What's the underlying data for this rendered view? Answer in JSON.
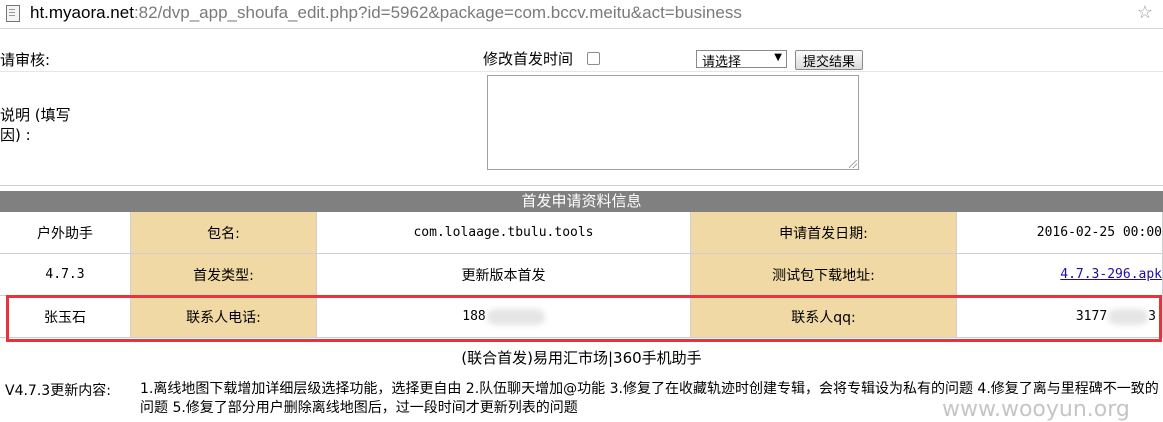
{
  "address_bar": {
    "host": "ht.myaora.net",
    "path": ":82/dvp_app_shoufa_edit.php?id=5962&package=com.bccv.meitu&act=business"
  },
  "form": {
    "review_label": "请审核:",
    "modify_time_label": "修改首发时间",
    "modify_time_checked": false,
    "select_value": "请选择",
    "submit_label": "提交结果",
    "reason_label_line1": "说明 (填写",
    "reason_label_line2": "因) :",
    "reason_value": ""
  },
  "section_title": "首发申请资料信息",
  "info": {
    "app_name": "户外助手",
    "package_label": "包名:",
    "package_value": "com.lolaage.tbulu.tools",
    "apply_date_label": "申请首发日期:",
    "apply_date_value": "2016-02-25 00:00",
    "version": "4.7.3",
    "type_label": "首发类型:",
    "type_value": "更新版本首发",
    "test_url_label": "测试包下载地址:",
    "test_url_value": "4.7.3-296.apk",
    "contact_name": "张玉石",
    "phone_label": "联系人电话:",
    "phone_visible": "188",
    "qq_label": "联系人qq:",
    "qq_visible_prefix": "3177",
    "qq_visible_suffix": "3"
  },
  "markets": "(联合首发)易用汇市场|360手机助手",
  "update": {
    "label": "V4.7.3更新内容:",
    "text": "1.离线地图下载增加详细层级选择功能，选择更自由 2.队伍聊天增加@功能 3.修复了在收藏轨迹时创建专辑，会将专辑设为私有的问题 4.修复了离与里程碑不一致的问题 5.修复了部分用户删除离线地图后，过一段时间才更新列表的问题"
  },
  "watermark": "www.wooyun.org",
  "colors": {
    "header_bg": "#808080",
    "label_cell_bg": "#f0d9a5",
    "highlight_border": "#e8323c",
    "link": "#1a0dab"
  }
}
